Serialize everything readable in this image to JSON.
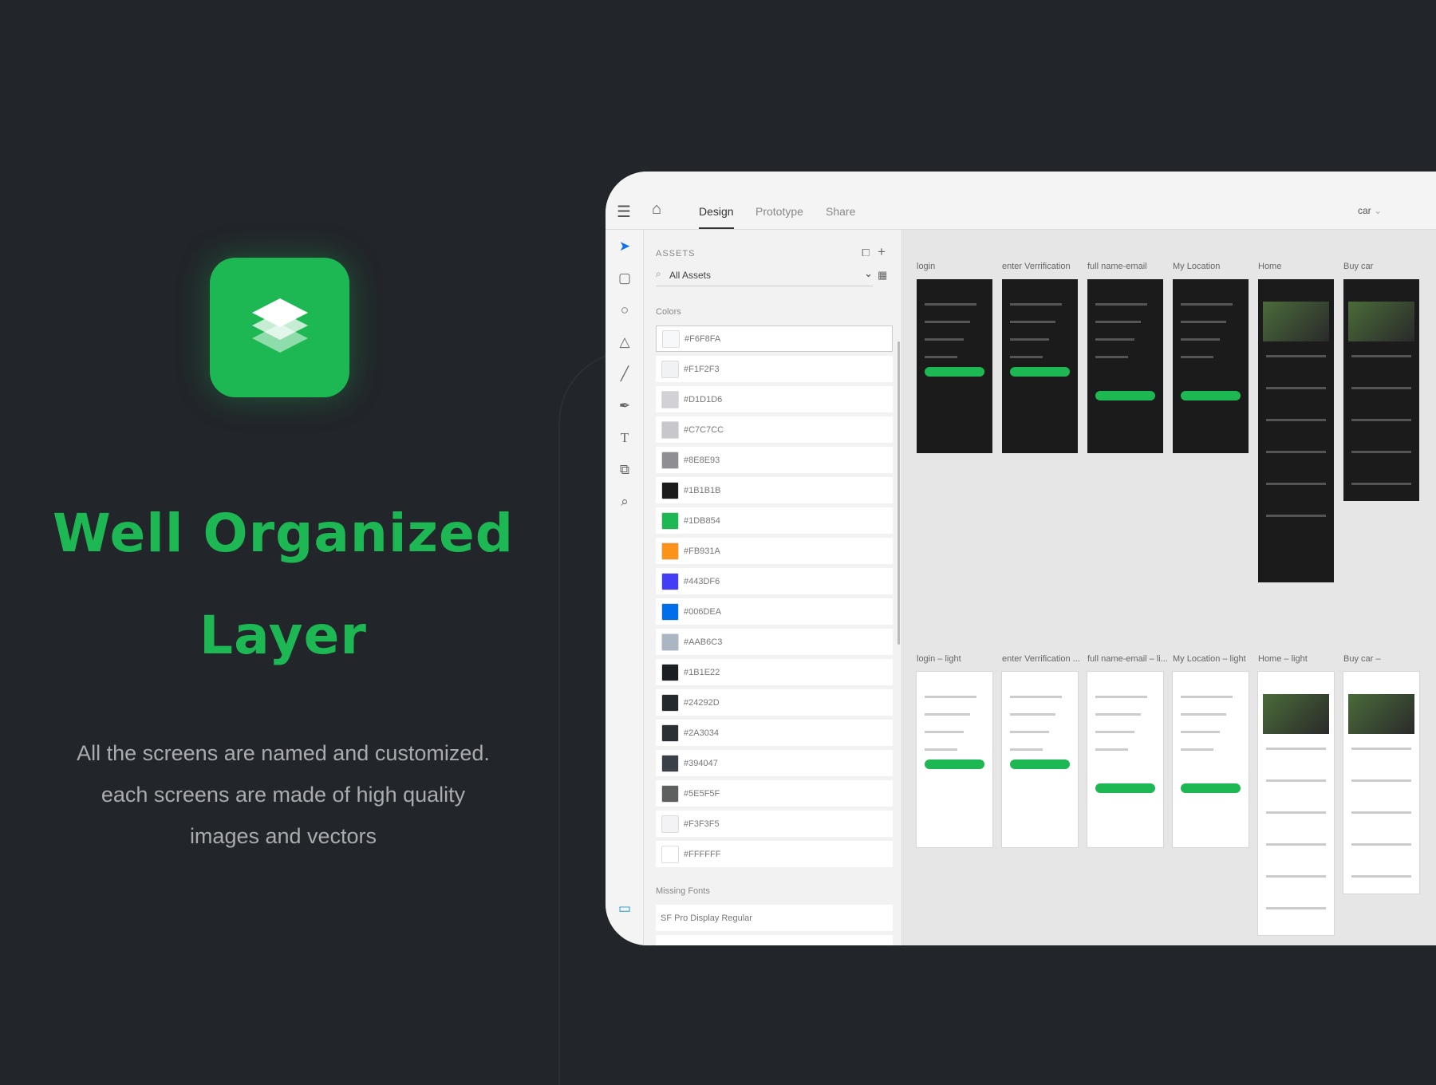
{
  "promo": {
    "headline_line1": "Well Organized",
    "headline_line2": "Layer",
    "body_lines": [
      "All the screens are named and customized.",
      "each screens are made of high quality",
      "images and vectors"
    ],
    "accent": "#1DB854"
  },
  "app": {
    "tabs": [
      "Design",
      "Prototype",
      "Share"
    ],
    "active_tab": "Design",
    "document_name": "car",
    "assets": {
      "title": "ASSETS",
      "filter": "All Assets",
      "colors_label": "Colors",
      "colors": [
        "#F6F8FA",
        "#F1F2F3",
        "#D1D1D6",
        "#C7C7CC",
        "#8E8E93",
        "#1B1B1B",
        "#1DB854",
        "#FB931A",
        "#443DF6",
        "#006DEA",
        "#AAB6C3",
        "#1B1E22",
        "#24292D",
        "#2A3034",
        "#394047",
        "#5E5F5F",
        "#F3F3F5",
        "#FFFFFF"
      ],
      "missing_fonts_label": "Missing Fonts",
      "missing_fonts": [
        "SF Pro Display Regular"
      ]
    },
    "artboards_dark": [
      "login",
      "enter Verrification",
      "full name-email",
      "My Location",
      "Home",
      "Buy car"
    ],
    "artboards_light": [
      "login – light",
      "enter Verrification ...",
      "full name-email – li...",
      "My Location – light",
      "Home – light",
      "Buy car –"
    ]
  }
}
